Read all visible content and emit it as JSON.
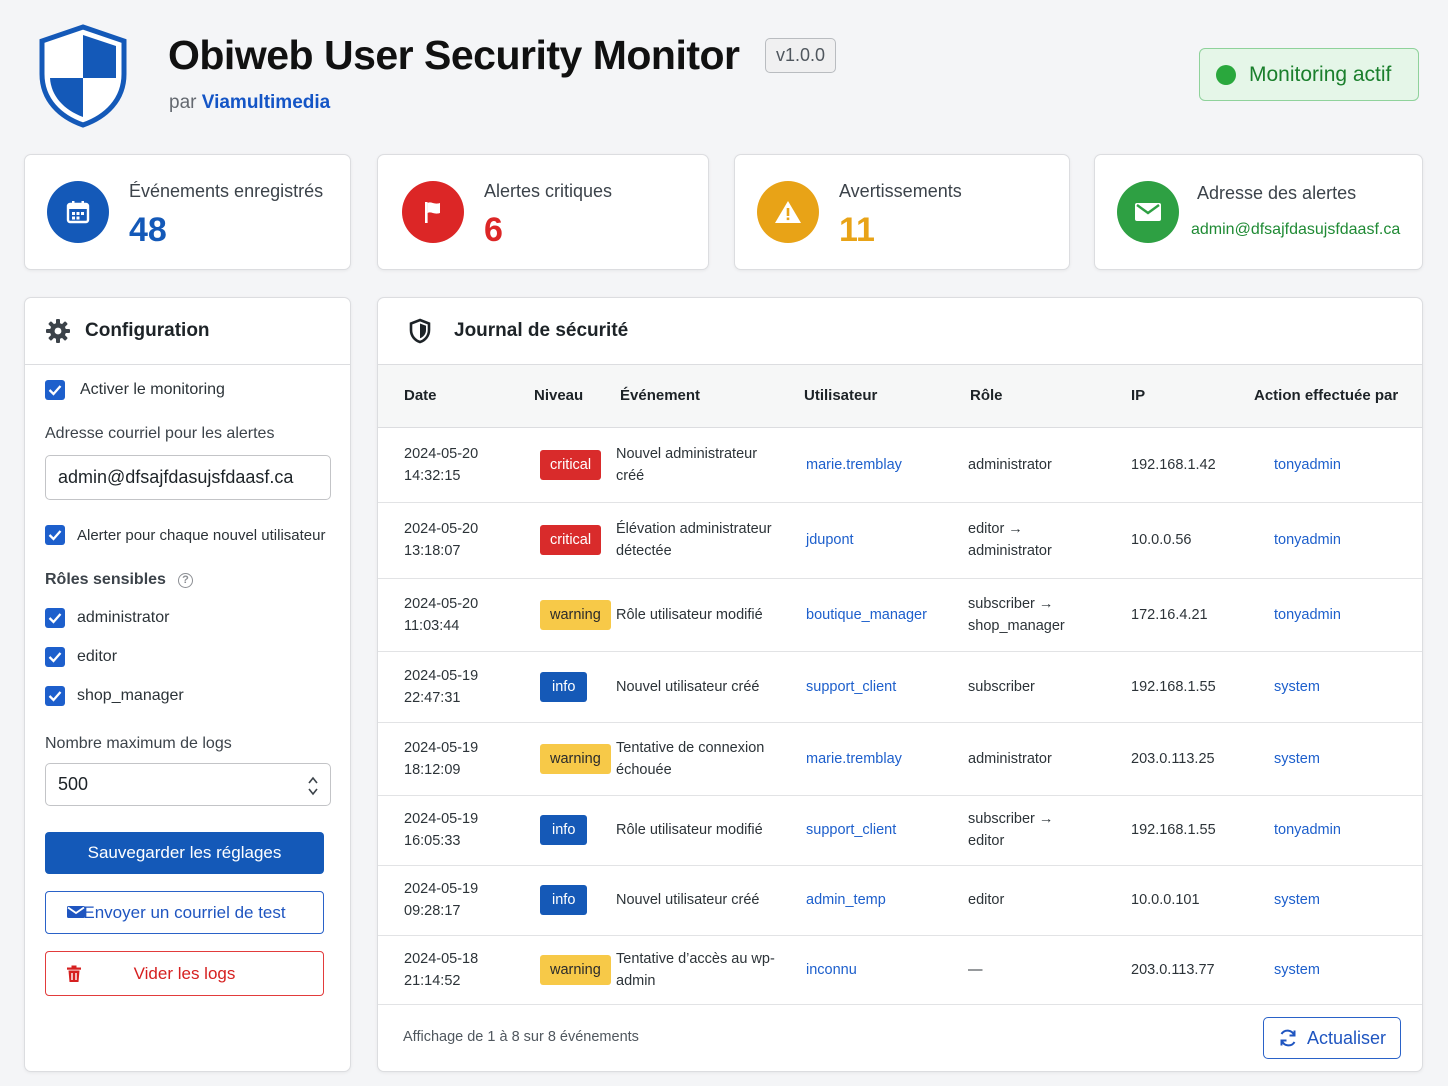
{
  "header": {
    "title": "Obiweb User Security Monitor",
    "version": "v1.0.0",
    "by_prefix": "par",
    "by_name": "Viamultimedia",
    "status": "Monitoring actif"
  },
  "stats": [
    {
      "label": "Événements enregistrés",
      "value": "48",
      "color": "#1459b8",
      "icon": "calendar-icon"
    },
    {
      "label": "Alertes critiques",
      "value": "6",
      "color": "#dc2626",
      "icon": "flag-icon"
    },
    {
      "label": "Avertissements",
      "value": "11",
      "color": "#e8a317",
      "icon": "warning-icon"
    },
    {
      "label": "Adresse des alertes",
      "value": "admin@dfsajfdasujsfdaasf.ca",
      "color": "#2ea043",
      "icon": "envelope-icon"
    }
  ],
  "config": {
    "title": "Configuration",
    "enable_monitoring": "Activer le monitoring",
    "email_label": "Adresse courriel pour les alertes",
    "email_value": "admin@dfsajfdasujsfdaasf.ca",
    "alert_new_user": "Alerter pour chaque nouvel utilisateur",
    "roles_label": "Rôles sensibles",
    "help": "?",
    "roles": [
      "administrator",
      "editor",
      "shop_manager"
    ],
    "max_logs_label": "Nombre maximum de logs",
    "max_logs_value": "500",
    "save": "Sauvegarder les réglages",
    "test_email": "Envoyer un courriel de test",
    "clear_logs": "Vider les logs"
  },
  "log": {
    "title": "Journal de sécurité",
    "columns": [
      "Date",
      "Niveau",
      "Événement",
      "Utilisateur",
      "Rôle",
      "IP",
      "Action effectuée par"
    ],
    "rows": [
      {
        "date": "2024-05-20",
        "time": "14:32:15",
        "level": "critical",
        "event": "Nouvel administrateur créé",
        "user": "marie.tremblay",
        "role": "administrator",
        "ip": "192.168.1.42",
        "by": "tonyadmin"
      },
      {
        "date": "2024-05-20",
        "time": "13:18:07",
        "level": "critical",
        "event": "Élévation administrateur détectée",
        "user": "jdupont",
        "role": "editor → administrator",
        "ip": "10.0.0.56",
        "by": "tonyadmin"
      },
      {
        "date": "2024-05-20",
        "time": "11:03:44",
        "level": "warning",
        "event": "Rôle utilisateur modifié",
        "user": "boutique_manager",
        "role": "subscriber → shop_manager",
        "ip": "172.16.4.21",
        "by": "tonyadmin"
      },
      {
        "date": "2024-05-19",
        "time": "22:47:31",
        "level": "info",
        "event": "Nouvel utilisateur créé",
        "user": "support_client",
        "role": "subscriber",
        "ip": "192.168.1.55",
        "by": "system"
      },
      {
        "date": "2024-05-19",
        "time": "18:12:09",
        "level": "warning",
        "event": "Tentative de connexion échouée",
        "user": "marie.tremblay",
        "role": "administrator",
        "ip": "203.0.113.25",
        "by": "system"
      },
      {
        "date": "2024-05-19",
        "time": "16:05:33",
        "level": "info",
        "event": "Rôle utilisateur modifié",
        "user": "support_client",
        "role": "subscriber → editor",
        "ip": "192.168.1.55",
        "by": "tonyadmin"
      },
      {
        "date": "2024-05-19",
        "time": "09:28:17",
        "level": "info",
        "event": "Nouvel utilisateur créé",
        "user": "admin_temp",
        "role": "editor",
        "ip": "10.0.0.101",
        "by": "system"
      },
      {
        "date": "2024-05-18",
        "time": "21:14:52",
        "level": "warning",
        "event": "Tentative d’accès au wp-admin",
        "user": "inconnu",
        "role": "—",
        "ip": "203.0.113.77",
        "by": "system"
      }
    ],
    "footer": "Affichage de 1 à 8 sur 8 événements",
    "refresh": "Actualiser"
  }
}
